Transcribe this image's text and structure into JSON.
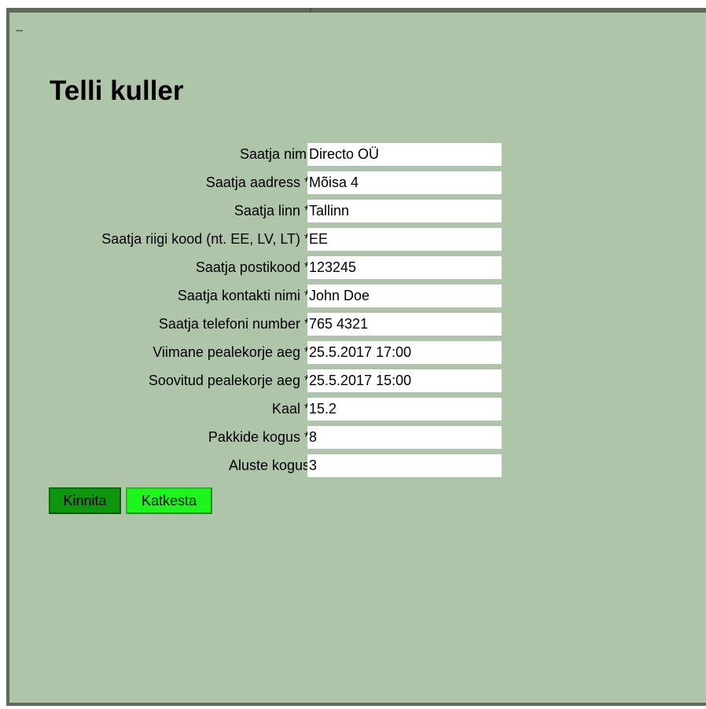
{
  "page": {
    "title": "Telli kuller"
  },
  "form": {
    "fields": [
      {
        "label": "Saatja nimi",
        "value": "Directo OÜ"
      },
      {
        "label": "Saatja aadress *",
        "value": "Mõisa 4"
      },
      {
        "label": "Saatja linn *",
        "value": "Tallinn"
      },
      {
        "label": "Saatja riigi kood (nt. EE, LV, LT) *",
        "value": "EE"
      },
      {
        "label": "Saatja postikood *",
        "value": "123245"
      },
      {
        "label": "Saatja kontakti nimi *",
        "value": "John Doe"
      },
      {
        "label": "Saatja telefoni number *",
        "value": "765 4321"
      },
      {
        "label": "Viimane pealekorje aeg *",
        "value": "25.5.2017 17:00"
      },
      {
        "label": "Soovitud pealekorje aeg *",
        "value": "25.5.2017 15:00"
      },
      {
        "label": "Kaal *",
        "value": "15.2"
      },
      {
        "label": "Pakkide kogus *",
        "value": "8"
      },
      {
        "label": "Aluste kogus",
        "value": "3"
      }
    ]
  },
  "buttons": {
    "confirm_label": "Kinnita",
    "cancel_label": "Katkesta"
  },
  "colors": {
    "panel_background": "#afc5aa",
    "panel_border": "#5f6b5a",
    "confirm_button": "#0e960e",
    "cancel_button": "#1df51d"
  }
}
